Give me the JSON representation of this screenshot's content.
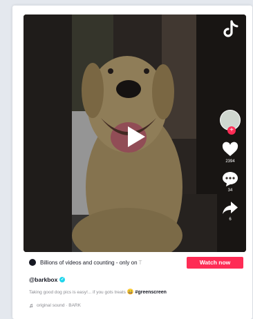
{
  "video": {
    "icons": {
      "logo": "tiktok-logo-icon",
      "play": "play-icon",
      "like": "heart-icon",
      "comment": "comment-icon",
      "share": "share-icon"
    },
    "like_count": "2394",
    "comment_count": "34",
    "share_count": "6"
  },
  "banner": {
    "text": "Billions of videos and counting - only on",
    "faded_text": "T",
    "button_label": "Watch now"
  },
  "post": {
    "username": "@barkbox",
    "verified_mark": "✓",
    "caption": "Taking good dog pics is easy!... if you gots treats ",
    "caption_emoji": "😄",
    "hashtag": "#greenscreen",
    "sound": "original sound · BARK",
    "sound_icon": "♫"
  },
  "colors": {
    "accent": "#fe2c55",
    "verified": "#20d5ec",
    "text": "#161823",
    "muted": "#8a8b91"
  }
}
